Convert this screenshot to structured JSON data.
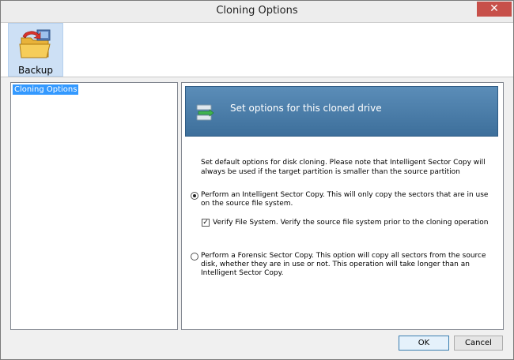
{
  "window": {
    "title": "Cloning Options",
    "close_glyph": "✕"
  },
  "toolbar": {
    "backup_label": "Backup",
    "backup_icon": "backup-folder-icon"
  },
  "tree": {
    "items": [
      {
        "label": "Cloning Options",
        "selected": true
      }
    ]
  },
  "banner": {
    "icon": "clone-drive-icon",
    "text": "Set options for this cloned drive"
  },
  "content": {
    "description": "Set default options for disk cloning.  Please note that Intelligent Sector Copy will always be used if the target partition is smaller than the source partition",
    "options": [
      {
        "label": "Perform an Intelligent Sector Copy.  This will only copy the sectors that are in use on the source file system.",
        "selected": true
      },
      {
        "label": "Perform a Forensic Sector Copy. This option will copy all sectors from the source disk, whether they are in use or not.  This operation will take longer than an Intelligent Sector Copy.",
        "selected": false
      }
    ],
    "verify": {
      "label": "Verify File System.  Verify the source file system prior to the cloning operation",
      "checked": true,
      "check_glyph": "✓"
    }
  },
  "buttons": {
    "ok": "OK",
    "cancel": "Cancel"
  }
}
